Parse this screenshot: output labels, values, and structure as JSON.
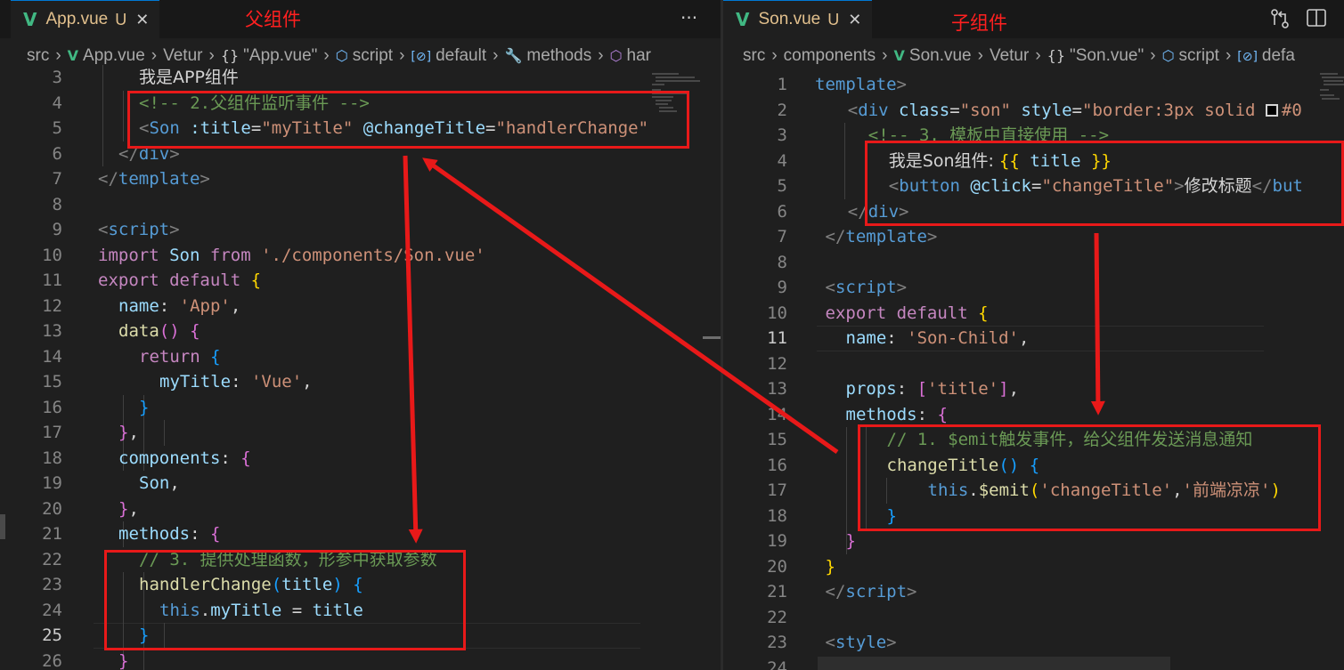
{
  "left": {
    "tab": {
      "name": "App.vue",
      "status": "U",
      "close": "✕"
    },
    "note": "父组件",
    "more": "···",
    "breadcrumb": [
      {
        "icon": "",
        "label": "src"
      },
      {
        "icon": "V",
        "label": "App.vue"
      },
      {
        "icon": "",
        "label": "Vetur"
      },
      {
        "icon": "{}",
        "label": "\"App.vue\""
      },
      {
        "icon": "⬡",
        "label": "script"
      },
      {
        "icon": "[⊘]",
        "label": "default"
      },
      {
        "icon": "🔧",
        "label": "methods"
      },
      {
        "icon": "⬡",
        "label": "har"
      }
    ],
    "lines": [
      {
        "n": "3",
        "segs": [
          [
            "ch",
            "我是APP组件"
          ]
        ]
      },
      {
        "n": "4",
        "segs": [
          [
            "c",
            "<!-- 2.父组件监听事件 -->"
          ]
        ]
      },
      {
        "n": "5",
        "segs": [
          [
            "br",
            "<"
          ],
          [
            "tag",
            "Son"
          ],
          [
            "x",
            " "
          ],
          [
            "a",
            ":title"
          ],
          [
            "x",
            "="
          ],
          [
            "s",
            "\"myTitle\""
          ],
          [
            "x",
            " "
          ],
          [
            "a",
            "@changeTitle"
          ],
          [
            "x",
            "="
          ],
          [
            "s",
            "\"handlerChange\""
          ]
        ]
      },
      {
        "n": "6",
        "segs": [
          [
            "br",
            "</"
          ],
          [
            "tag",
            "div"
          ],
          [
            "br",
            ">"
          ]
        ]
      },
      {
        "n": "7",
        "segs": [
          [
            "br",
            "</"
          ],
          [
            "tag",
            "template"
          ],
          [
            "br",
            ">"
          ]
        ]
      },
      {
        "n": "8",
        "segs": []
      },
      {
        "n": "9",
        "segs": [
          [
            "br",
            "<"
          ],
          [
            "tag",
            "script"
          ],
          [
            "br",
            ">"
          ]
        ]
      },
      {
        "n": "10",
        "segs": [
          [
            "k",
            "import"
          ],
          [
            "x",
            " "
          ],
          [
            "p",
            "Son"
          ],
          [
            "x",
            " "
          ],
          [
            "k",
            "from"
          ],
          [
            "x",
            " "
          ],
          [
            "s",
            "'./components/Son.vue'"
          ]
        ]
      },
      {
        "n": "11",
        "segs": [
          [
            "k",
            "export"
          ],
          [
            "x",
            " "
          ],
          [
            "k",
            "default"
          ],
          [
            "x",
            " "
          ],
          [
            "y",
            "{"
          ]
        ]
      },
      {
        "n": "12",
        "segs": [
          [
            "p",
            "name"
          ],
          [
            "x",
            ": "
          ],
          [
            "s",
            "'App'"
          ],
          [
            "x",
            ","
          ]
        ]
      },
      {
        "n": "13",
        "segs": [
          [
            "f",
            "data"
          ],
          [
            "m",
            "()"
          ],
          [
            "x",
            " "
          ],
          [
            "m",
            "{"
          ]
        ]
      },
      {
        "n": "14",
        "segs": [
          [
            "k",
            "return"
          ],
          [
            "x",
            " "
          ],
          [
            "b",
            "{"
          ]
        ]
      },
      {
        "n": "15",
        "segs": [
          [
            "p",
            "myTitle"
          ],
          [
            "x",
            ": "
          ],
          [
            "s",
            "'Vue'"
          ],
          [
            "x",
            ","
          ]
        ]
      },
      {
        "n": "16",
        "segs": [
          [
            "b",
            "}"
          ]
        ]
      },
      {
        "n": "17",
        "segs": [
          [
            "m",
            "}"
          ],
          [
            "x",
            ","
          ]
        ]
      },
      {
        "n": "18",
        "segs": [
          [
            "p",
            "components"
          ],
          [
            "x",
            ": "
          ],
          [
            "m",
            "{"
          ]
        ]
      },
      {
        "n": "19",
        "segs": [
          [
            "p",
            "Son"
          ],
          [
            "x",
            ","
          ]
        ]
      },
      {
        "n": "20",
        "segs": [
          [
            "m",
            "}"
          ],
          [
            "x",
            ","
          ]
        ]
      },
      {
        "n": "21",
        "segs": [
          [
            "p",
            "methods"
          ],
          [
            "x",
            ": "
          ],
          [
            "m",
            "{"
          ]
        ]
      },
      {
        "n": "22",
        "segs": [
          [
            "c",
            "// 3. 提供处理函数，形参中获取参数"
          ]
        ]
      },
      {
        "n": "23",
        "segs": [
          [
            "f",
            "handlerChange"
          ],
          [
            "b",
            "("
          ],
          [
            "p",
            "title"
          ],
          [
            "b",
            ")"
          ],
          [
            "x",
            " "
          ],
          [
            "b",
            "{"
          ]
        ]
      },
      {
        "n": "24",
        "segs": [
          [
            "kb",
            "this"
          ],
          [
            "x",
            "."
          ],
          [
            "p",
            "myTitle"
          ],
          [
            "x",
            " = "
          ],
          [
            "p",
            "title"
          ]
        ]
      },
      {
        "n": "25",
        "segs": [
          [
            "b",
            "}"
          ]
        ]
      },
      {
        "n": "26",
        "segs": [
          [
            "m",
            "}"
          ]
        ]
      }
    ]
  },
  "right": {
    "tab": {
      "name": "Son.vue",
      "status": "U",
      "close": "✕"
    },
    "note": "子组件",
    "breadcrumb": [
      {
        "icon": "",
        "label": "src"
      },
      {
        "icon": "",
        "label": "components"
      },
      {
        "icon": "V",
        "label": "Son.vue"
      },
      {
        "icon": "",
        "label": "Vetur"
      },
      {
        "icon": "{}",
        "label": "\"Son.vue\""
      },
      {
        "icon": "⬡",
        "label": "script"
      },
      {
        "icon": "[⊘]",
        "label": "defa"
      }
    ],
    "lines": [
      {
        "n": "1",
        "segs": [
          [
            "tag",
            "template"
          ],
          [
            "br",
            ">"
          ]
        ]
      },
      {
        "n": "2",
        "segs": [
          [
            "br",
            "<"
          ],
          [
            "tag",
            "div"
          ],
          [
            "x",
            " "
          ],
          [
            "a",
            "class"
          ],
          [
            "x",
            "="
          ],
          [
            "s",
            "\"son\""
          ],
          [
            "x",
            " "
          ],
          [
            "a",
            "style"
          ],
          [
            "x",
            "="
          ],
          [
            "s",
            "\"border:3px solid "
          ],
          [
            "sw",
            ""
          ],
          [
            "s",
            "#0"
          ]
        ]
      },
      {
        "n": "3",
        "segs": [
          [
            "c",
            "<!-- 3. 模板中直接使用 -->"
          ]
        ]
      },
      {
        "n": "4",
        "segs": [
          [
            "ch",
            "我是Son组件: "
          ],
          [
            "y",
            "{{"
          ],
          [
            "x",
            " "
          ],
          [
            "p",
            "title"
          ],
          [
            "x",
            " "
          ],
          [
            "y",
            "}}"
          ]
        ]
      },
      {
        "n": "5",
        "segs": [
          [
            "br",
            "<"
          ],
          [
            "tag",
            "button"
          ],
          [
            "x",
            " "
          ],
          [
            "a",
            "@click"
          ],
          [
            "x",
            "="
          ],
          [
            "s",
            "\"changeTitle\""
          ],
          [
            "br",
            ">"
          ],
          [
            "ch",
            "修改标题"
          ],
          [
            "br",
            "</"
          ],
          [
            "tag",
            "but"
          ]
        ]
      },
      {
        "n": "6",
        "segs": [
          [
            "br",
            "</"
          ],
          [
            "tag",
            "div"
          ],
          [
            "br",
            ">"
          ]
        ]
      },
      {
        "n": "7",
        "segs": [
          [
            "br",
            "</"
          ],
          [
            "tag",
            "template"
          ],
          [
            "br",
            ">"
          ]
        ]
      },
      {
        "n": "8",
        "segs": []
      },
      {
        "n": "9",
        "segs": [
          [
            "br",
            "<"
          ],
          [
            "tag",
            "script"
          ],
          [
            "br",
            ">"
          ]
        ]
      },
      {
        "n": "10",
        "segs": [
          [
            "k",
            "export"
          ],
          [
            "x",
            " "
          ],
          [
            "k",
            "default"
          ],
          [
            "x",
            " "
          ],
          [
            "y",
            "{"
          ]
        ]
      },
      {
        "n": "11",
        "segs": [
          [
            "p",
            "name"
          ],
          [
            "x",
            ": "
          ],
          [
            "s",
            "'Son-Child'"
          ],
          [
            "x",
            ","
          ]
        ]
      },
      {
        "n": "12",
        "segs": []
      },
      {
        "n": "13",
        "segs": [
          [
            "p",
            "props"
          ],
          [
            "x",
            ": "
          ],
          [
            "m",
            "["
          ],
          [
            "s",
            "'title'"
          ],
          [
            "m",
            "]"
          ],
          [
            "x",
            ","
          ]
        ]
      },
      {
        "n": "14",
        "segs": [
          [
            "p",
            "methods"
          ],
          [
            "x",
            ": "
          ],
          [
            "m",
            "{"
          ]
        ]
      },
      {
        "n": "15",
        "segs": [
          [
            "c",
            "// 1. $emit触发事件，给父组件发送消息通知"
          ]
        ]
      },
      {
        "n": "16",
        "segs": [
          [
            "f",
            "changeTitle"
          ],
          [
            "b",
            "()"
          ],
          [
            "x",
            " "
          ],
          [
            "b",
            "{"
          ]
        ]
      },
      {
        "n": "17",
        "segs": [
          [
            "kb",
            "this"
          ],
          [
            "x",
            "."
          ],
          [
            "f",
            "$emit"
          ],
          [
            "y",
            "("
          ],
          [
            "s",
            "'changeTitle'"
          ],
          [
            "x",
            ","
          ],
          [
            "s",
            "'前端凉凉'"
          ],
          [
            "y",
            ")"
          ]
        ]
      },
      {
        "n": "18",
        "segs": [
          [
            "b",
            "}"
          ]
        ]
      },
      {
        "n": "19",
        "segs": [
          [
            "m",
            "}"
          ]
        ]
      },
      {
        "n": "20",
        "segs": [
          [
            "y",
            "}"
          ]
        ]
      },
      {
        "n": "21",
        "segs": [
          [
            "br",
            "</"
          ],
          [
            "tag",
            "script"
          ],
          [
            "br",
            ">"
          ]
        ]
      },
      {
        "n": "22",
        "segs": []
      },
      {
        "n": "23",
        "segs": [
          [
            "br",
            "<"
          ],
          [
            "tag",
            "style"
          ],
          [
            "br",
            ">"
          ]
        ]
      },
      {
        "n": "24",
        "segs": []
      }
    ]
  },
  "colors": {
    "annotation": "#e81919",
    "vue_green": "#41b883",
    "untracked": "#e2c08d",
    "editor_bg": "#1f1f1f"
  },
  "icons": {
    "tab": "vue-icon",
    "actions": [
      "compare-changes-icon",
      "split-editor-icon"
    ]
  }
}
